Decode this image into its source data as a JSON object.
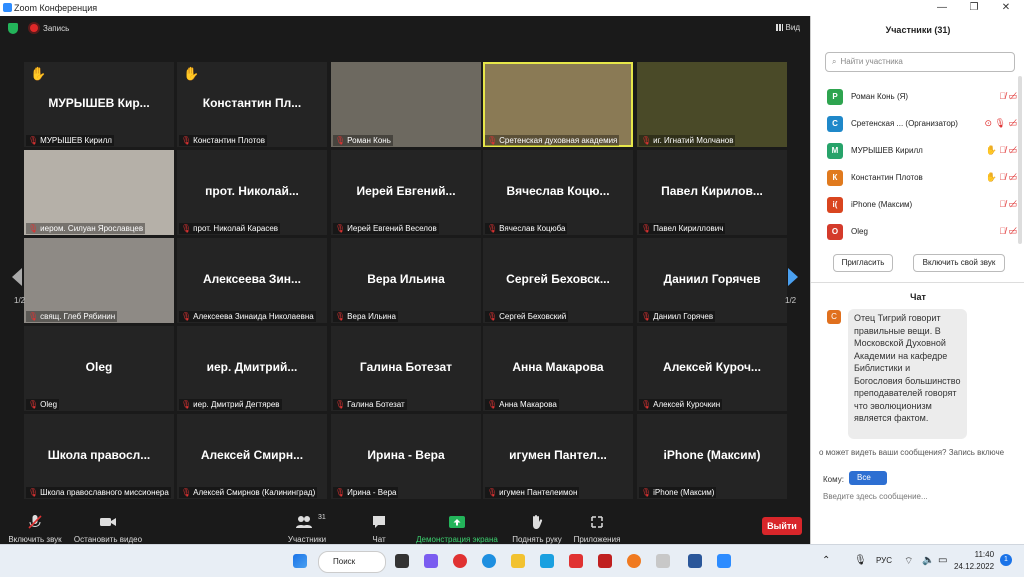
{
  "window": {
    "title": "Zoom Конференция",
    "minimize": "—",
    "restore": "❐",
    "close": "✕"
  },
  "topbar": {
    "recording": "Запись",
    "view": "Вид"
  },
  "tiles": [
    {
      "big": "МУРЫШЕВ Кир...",
      "caption": "МУРЫШЕВ Кирилл",
      "hand": "✋"
    },
    {
      "big": "Константин Пл...",
      "caption": "Константин Плотов",
      "hand": "✋"
    },
    {
      "big": "",
      "caption": "Роман Конь"
    },
    {
      "big": "",
      "caption": "Сретенская духовная академия"
    },
    {
      "big": "",
      "caption": "иг. Игнатий Молчанов"
    },
    {
      "big": "",
      "caption": "иером. Силуан Ярославцев"
    },
    {
      "big": "прот. Николай...",
      "caption": "прот. Николай Карасев"
    },
    {
      "big": "Иерей Евгений...",
      "caption": "Иерей Евгений Веселов"
    },
    {
      "big": "Вячеслав Коцю...",
      "caption": "Вячеслав Коцюба"
    },
    {
      "big": "Павел Кирилов...",
      "caption": "Павел Кириллович"
    },
    {
      "big": "",
      "caption": "свящ. Глеб Рябинин"
    },
    {
      "big": "Алексеева Зин...",
      "caption": "Алексеева Зинаида Николаевна"
    },
    {
      "big": "Вера Ильина",
      "caption": "Вера Ильина"
    },
    {
      "big": "Сергей Беховск...",
      "caption": "Сергей Беховский"
    },
    {
      "big": "Даниил Горячев",
      "caption": "Даниил Горячев"
    },
    {
      "big": "Oleg",
      "caption": "Oleg"
    },
    {
      "big": "иер. Дмитрий...",
      "caption": "иер. Дмитрий Дегтярев"
    },
    {
      "big": "Галина Ботезат",
      "caption": "Галина Ботезат"
    },
    {
      "big": "Анна Макарова",
      "caption": "Анна Макарова"
    },
    {
      "big": "Алексей Куроч...",
      "caption": "Алексей Курочкин"
    },
    {
      "big": "Школа правосл...",
      "caption": "Школа православного миссионера"
    },
    {
      "big": "Алексей Смирн...",
      "caption": "Алексей Смирнов (Калининград)"
    },
    {
      "big": "Ирина - Вера",
      "caption": "Ирина - Вера"
    },
    {
      "big": "игумен Пантел...",
      "caption": "игумен Пантелеимон"
    },
    {
      "big": "iPhone (Максим)",
      "caption": "iPhone (Максим)"
    }
  ],
  "pages": {
    "left": "1/2",
    "right": "1/2"
  },
  "toolbar": {
    "audio": "Включить звук",
    "video": "Остановить видео",
    "participants": "Участники",
    "participants_count": "31",
    "chat": "Чат",
    "share": "Демонстрация экрана",
    "raise_hand": "Поднять руку",
    "apps": "Приложения",
    "leave": "Выйти"
  },
  "participants_panel": {
    "title": "Участники (31)",
    "search_placeholder": "Найти участника",
    "rows": [
      {
        "initial": "Р",
        "name": "Роман Конь (Я)",
        "color": "#2ea44f"
      },
      {
        "initial": "С",
        "name": "Сретенская ... (Организатор)",
        "color": "#1f88c9"
      },
      {
        "initial": "М",
        "name": "МУРЫШЕВ Кирилл",
        "color": "#27a36a"
      },
      {
        "initial": "К",
        "name": "Константин Плотов",
        "color": "#e07a1e"
      },
      {
        "initial": "i(",
        "name": "iPhone (Максим)",
        "color": "#d9451f"
      },
      {
        "initial": "O",
        "name": "Oleg",
        "color": "#d43b2b"
      }
    ],
    "invite": "Пригласить",
    "unmute_self": "Включить свой звук"
  },
  "chat_panel": {
    "title": "Чат",
    "sender_initial": "С",
    "message": "Отец Тигрий говорит правильные вещи. В Московской Духовной Академии на кафедре Библистики и Богословия большинство преподавателей говорят что эволюционизм является фактом.",
    "notice": "о может видеть ваши сообщения? Запись включе",
    "to_label": "Кому:",
    "to_value": "Все",
    "input_placeholder": "Введите здесь сообщение..."
  },
  "taskbar": {
    "search": "Поиск",
    "lang": "РУС",
    "time": "11:40",
    "date": "24.12.2022"
  }
}
